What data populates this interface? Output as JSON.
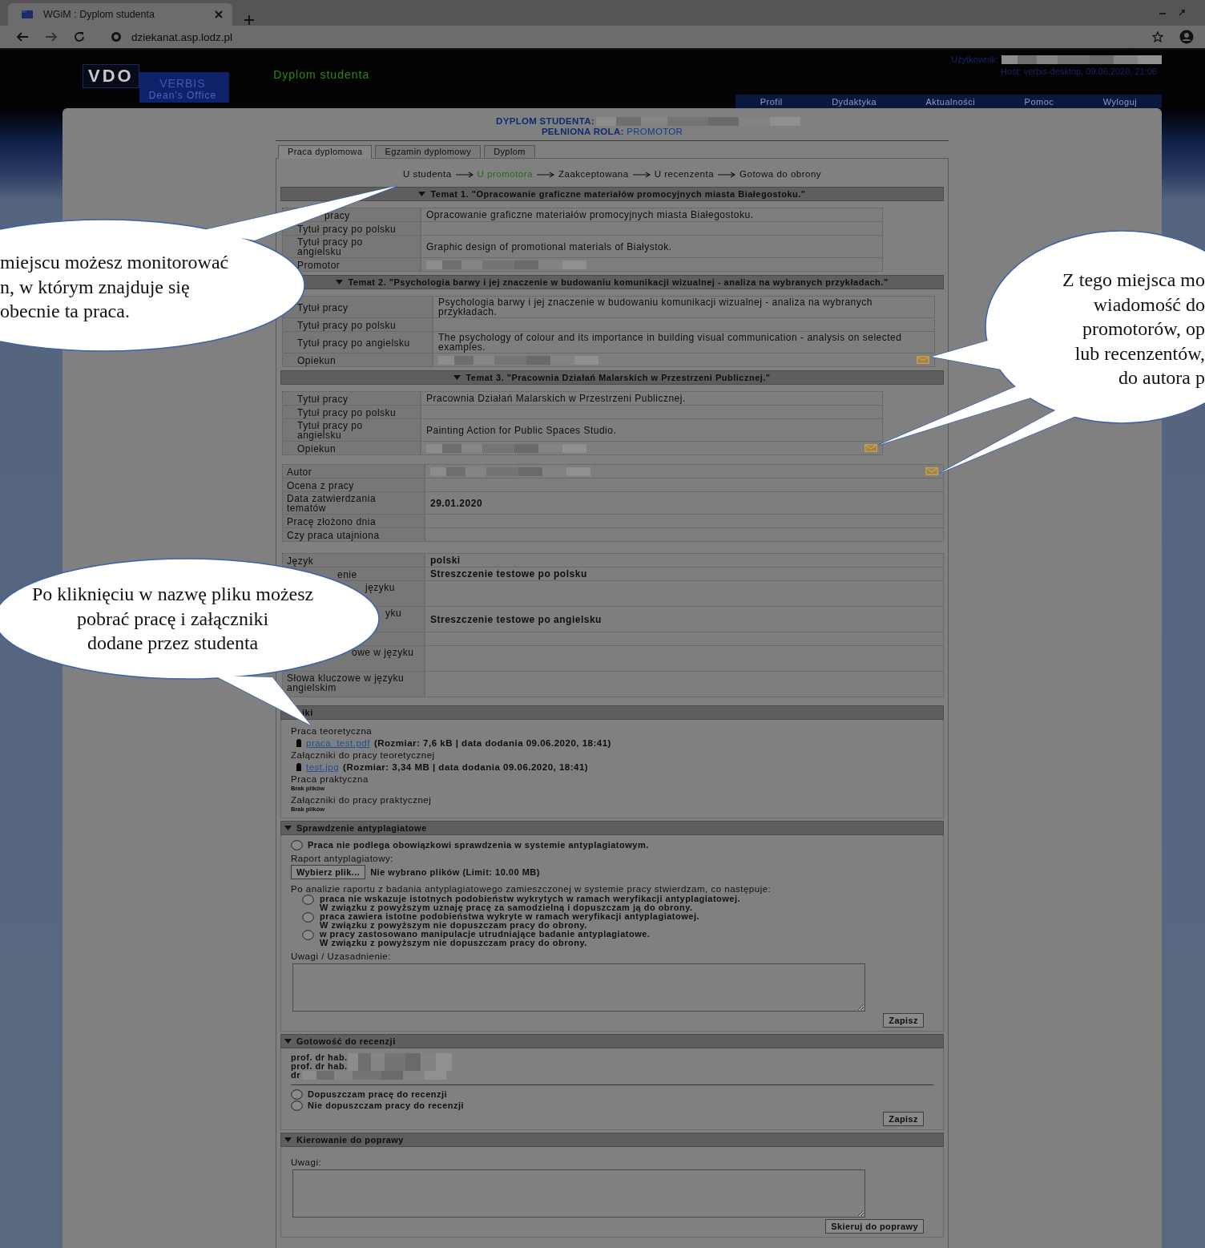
{
  "browser": {
    "tab_title": "WGiM : Dyplom studenta",
    "url": "dziekanat.asp.lodz.pl"
  },
  "header": {
    "logo_mark": "VDO",
    "logo_name": "VERBIS",
    "logo_subtitle": "Dean's Office",
    "module_title": "Dyplom studenta",
    "user_label": "Użytkownik:",
    "host": "Host: verbis-desktop, 09.06.2020, 21:06",
    "nav": [
      "Profil",
      "Dydaktyka",
      "Aktualności",
      "Pomoc",
      "Wyloguj"
    ]
  },
  "page_title": {
    "label": "DYPLOM STUDENTA:",
    "role_label": "PEŁNIONA ROLA:",
    "role": "PROMOTOR"
  },
  "tabs": [
    {
      "label": "Praca dyplomowa",
      "selected": true
    },
    {
      "label": "Egzamin dyplomowy",
      "selected": false
    },
    {
      "label": "Dyplom",
      "selected": false
    }
  ],
  "workflow": [
    {
      "label": "U studenta",
      "current": false
    },
    {
      "label": "U promotora",
      "current": true
    },
    {
      "label": "Zaakceptowana",
      "current": false
    },
    {
      "label": "U recenzenta",
      "current": false
    },
    {
      "label": "Gotowa do obrony",
      "current": false
    }
  ],
  "topics": [
    {
      "title": "Temat 1. \"Opracowanie graficzne materiałów promocyjnych miasta Białegostoku.\"",
      "expanded": true,
      "rows": [
        {
          "label": "pracy",
          "value": "Opracowanie graficzne materiałów promocyjnych miasta Białegostoku.",
          "blurred": false,
          "mail": false
        },
        {
          "label": "Tytuł pracy po polsku",
          "blurred": false,
          "mail": false
        },
        {
          "label": "Tytuł pracy po angielsku",
          "value": "Graphic design of promotional materials of Białystok.",
          "blurred": false,
          "mail": false
        },
        {
          "label": "Promotor",
          "blurred": true,
          "mail": false
        }
      ]
    },
    {
      "title": "Temat 2. \"Psychologia barwy i jej znaczenie w budowaniu komunikacji wizualnej - analiza na wybranych przykładach.\"",
      "expanded": true,
      "rows": [
        {
          "label": "Tytuł pracy",
          "value": "Psychologia barwy i jej znaczenie w budowaniu komunikacji wizualnej - analiza na wybranych przykładach.",
          "blurred": false,
          "mail": false
        },
        {
          "label": "Tytuł pracy po polsku",
          "blurred": false,
          "mail": false
        },
        {
          "label": "Tytuł pracy po angielsku",
          "value": "The psychology of colour and its importance in building visual communication - analysis on selected examples.",
          "blurred": false,
          "mail": false
        },
        {
          "label": "Opiekun",
          "blurred": true,
          "mail": true
        }
      ]
    },
    {
      "title": "Temat 3. \"Pracownia Działań Malarskich w Przestrzeni Publicznej.\"",
      "expanded": true,
      "rows": [
        {
          "label": "Tytuł pracy",
          "value": "Pracownia Działań Malarskich w Przestrzeni Publicznej.",
          "blurred": false,
          "mail": false
        },
        {
          "label": "Tytuł pracy po polsku",
          "blurred": false,
          "mail": false
        },
        {
          "label": "Tytuł pracy po angielsku",
          "value": "Painting Action for Public Spaces Studio.",
          "blurred": false,
          "mail": false
        },
        {
          "label": "Opiekun",
          "blurred": true,
          "mail": true
        }
      ]
    }
  ],
  "details": [
    {
      "label": "Autor",
      "blurred": true,
      "mail": true
    },
    {
      "label": "Ocena z pracy",
      "blurred": false,
      "mail": false
    },
    {
      "label": "Data zatwierdzania tematów",
      "value": "29.01.2020",
      "blurred": false,
      "mail": false
    },
    {
      "label": "Pracę złożono dnia",
      "blurred": false,
      "mail": false
    },
    {
      "label": "Czy praca utajniona",
      "blurred": false,
      "mail": false
    }
  ],
  "language": [
    {
      "label": "Język",
      "value": "polski",
      "blurred": false,
      "mail": false
    },
    {
      "label": "enie",
      "value": "Streszczenie testowe po polsku",
      "blurred": false,
      "mail": false
    },
    {
      "label": "języku",
      "blurred": false,
      "mail": false
    },
    {
      "label": "yku",
      "value": "Streszczenie testowe po angielsku",
      "blurred": false,
      "mail": false
    },
    {
      "blurred": false,
      "mail": false
    },
    {
      "label": "owe w języku",
      "blurred": false,
      "mail": false
    },
    {
      "label": "Słowa kluczowe w języku angielskim",
      "blurred": false,
      "mail": false
    }
  ],
  "files": {
    "title": "iki",
    "groups": [
      {
        "label": "Praca teoretyczna",
        "files": [
          {
            "name": "praca_test.pdf",
            "info": "(Rozmiar: 7,6 kB | data dodania 09.06.2020, 18:41)"
          }
        ]
      },
      {
        "label": "Załączniki do pracy teoretycznej",
        "files": [
          {
            "name": "test.jpg",
            "info": "(Rozmiar: 3,34 MB | data dodania 09.06.2020, 18:41)"
          }
        ]
      },
      {
        "label": "Praca praktyczna",
        "empty": "Brak plików"
      },
      {
        "label": "Załączniki do pracy praktycznej",
        "empty": "Brak plików"
      }
    ]
  },
  "plagiarism": {
    "title": "Sprawdzenie antyplagiatowe",
    "expanded": true,
    "exempt": {
      "label": "Praca nie podlega obowiązkowi sprawdzenia w systemie antyplagiatowym.",
      "selected": false
    },
    "report_label": "Raport antyplagiatowy:",
    "file_button": "Wybierz plik...",
    "file_status": "Nie wybrano plików (Limit: 10.00 MB)",
    "intro": "Po analizie raportu z badania antyplagiatowego zamieszczonej w systemie pracy stwierdzam, co następuje:",
    "options": [
      {
        "lines": [
          "praca nie wskazuje istotnych podobieństw wykrytych w ramach weryfikacji antyplagiatowej.",
          "W związku z powyższym uznaję pracę za samodzielną i dopuszczam ją do obrony."
        ],
        "selected": false
      },
      {
        "lines": [
          "praca zawiera istotne podobieństwa wykryte w ramach weryfikacji antyplagiatowej.",
          "W związku z powyższym nie dopuszczam pracy do obrony."
        ],
        "selected": false
      },
      {
        "lines": [
          "w pracy zastosowano manipulacje utrudniające badanie antyplagiatowe.",
          "W związku z powyższym nie dopuszczam pracy do obrony."
        ],
        "selected": false
      }
    ],
    "notes_label": "Uwagi / Uzasadnienie:",
    "save": "Zapisz"
  },
  "review": {
    "title": "Gotowość do recenzji",
    "expanded": true,
    "reviewers": [
      "prof. dr hab.",
      "prof. dr hab.",
      "dr"
    ],
    "options": [
      {
        "label": "Dopuszczam pracę do recenzji",
        "selected": false
      },
      {
        "label": "Nie dopuszczam pracy do recenzji",
        "selected": false
      }
    ],
    "save": "Zapisz"
  },
  "correction": {
    "title": "Kierowanie do poprawy",
    "expanded": true,
    "notes_label": "Uwagi:",
    "submit": "Skieruj do poprawy"
  },
  "callouts": [
    {
      "lines": [
        "miejscu możesz monitorować",
        "n, w którym znajduje się",
        "obecnie ta praca."
      ]
    },
    {
      "lines": [
        "Z tego miejsca mo",
        "wiadomość do",
        "promotorów, op",
        "lub recenzentów,",
        "do autora p"
      ]
    },
    {
      "lines": [
        "Po kliknięciu w nazwę pliku możesz",
        "pobrać pracę i załączniki",
        "dodane przez studenta"
      ]
    }
  ]
}
